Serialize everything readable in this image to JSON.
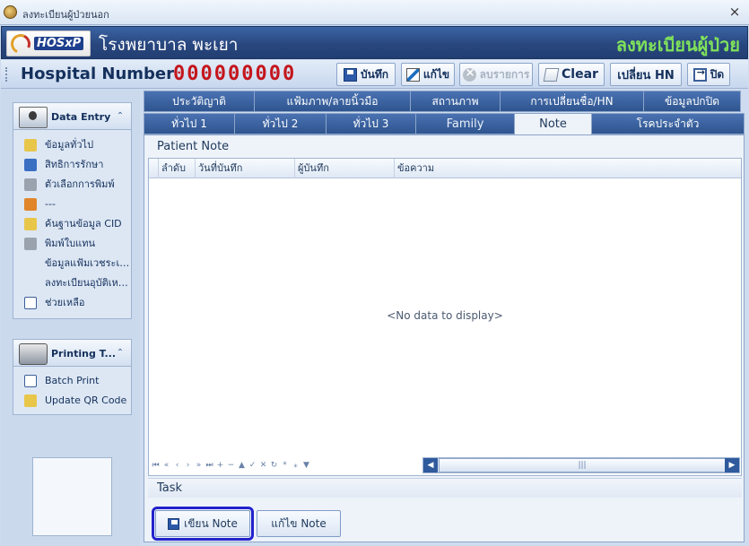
{
  "window": {
    "title": "ลงทะเบียนผู้ป่วยนอก",
    "close_glyph": "×"
  },
  "banner": {
    "logo_text": "HOSxP",
    "hospital_name": "โรงพยาบาล พะเยา",
    "module_title": "ลงทะเบียนผู้ป่วย"
  },
  "toolbar": {
    "hn_label": "Hospital Number",
    "hn_value": "000000000",
    "save_label": "บันทึก",
    "edit_label": "แก้ไข",
    "cancel_label": "ลบรายการ",
    "clear_label": "Clear",
    "change_hn_label": "เปลี่ยน HN",
    "close_label": "ปิด"
  },
  "sidebar": {
    "data_entry": {
      "title": "Data Entry",
      "items": [
        {
          "label": "ข้อมูลทั่วไป",
          "icon": "info-icon"
        },
        {
          "label": "สิทธิการรักษา",
          "icon": "rights-icon"
        },
        {
          "label": "ตัวเลือกการพิมพ์",
          "icon": "print-options-icon"
        },
        {
          "label": "---",
          "icon": "people-icon"
        },
        {
          "label": "ค้นฐานข้อมูล CID",
          "icon": "search-cid-icon"
        },
        {
          "label": "พิมพ์ใบแทน",
          "icon": "printer-icon"
        },
        {
          "label": "ข้อมูลแฟ้มเวชระเบียน...",
          "icon": "none"
        },
        {
          "label": "ลงทะเบียนอุบัติเหตุ...",
          "icon": "none"
        },
        {
          "label": "ช่วยเหลือ",
          "icon": "help-icon"
        }
      ]
    },
    "printing": {
      "title": "Printing T...",
      "items": [
        {
          "label": "Batch Print",
          "icon": "batch-print-icon"
        },
        {
          "label": "Update QR Code",
          "icon": "qr-code-icon"
        }
      ]
    }
  },
  "tabs_top": [
    "ประวัติญาติ",
    "แฟ้มภาพ/ลายนิ้วมือ",
    "สถานภาพ",
    "การเปลี่ยนชื่อ/HN",
    "ข้อมูลปกปิด"
  ],
  "tabs_bottom": [
    "ทั่วไป 1",
    "ทั่วไป 2",
    "ทั่วไป 3",
    "Family",
    "Note",
    "โรคประจำตัว"
  ],
  "active_tab": "Note",
  "patient_note": {
    "section_label": "Patient Note",
    "columns": [
      "ลำดับ",
      "วันที่บันทึก",
      "ผู้บันทึก",
      "ข้อความ"
    ],
    "empty_message": "<No data to display>",
    "navigator": [
      "⏮",
      "«",
      "‹",
      "›",
      "»",
      "⏭",
      "+",
      "−",
      "▲",
      "✓",
      "✕",
      "↻",
      "*",
      "⁎",
      "▼"
    ],
    "scroll_grip": "|||"
  },
  "task": {
    "section_label": "Task",
    "write_note_label": "เขียน Note",
    "edit_note_label": "แก้ไข Note"
  }
}
